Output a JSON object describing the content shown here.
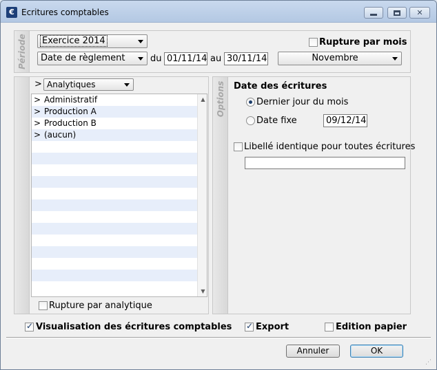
{
  "window": {
    "title": "Ecritures comptables",
    "icon_glyph": "€",
    "minimize_label": "minimize",
    "maximize_label": "maximize",
    "close_glyph": "✕"
  },
  "periode": {
    "section_label": "Période",
    "exercice_value": "Exercice 2014",
    "date_type_value": "Date de règlement",
    "du_label": "du",
    "date_from": "01/11/14",
    "au_label": "au",
    "date_to": "30/11/14",
    "month_value": "Novembre",
    "rupture_mois_label": "Rupture par mois",
    "rupture_mois_checked": false
  },
  "analytique": {
    "chevron": ">",
    "selector_value": "Analytiques",
    "items": [
      {
        "chevron": ">",
        "label": "Administratif"
      },
      {
        "chevron": ">",
        "label": "Production A"
      },
      {
        "chevron": ">",
        "label": "Production B"
      },
      {
        "chevron": ">",
        "label": "(aucun)"
      }
    ],
    "rupture_label": "Rupture par analytique",
    "rupture_checked": false
  },
  "options": {
    "section_label": "Options",
    "date_title": "Date des écritures",
    "radio_last_day_label": "Dernier jour du mois",
    "radio_last_day_checked": true,
    "radio_fixed_label": "Date fixe",
    "radio_fixed_checked": false,
    "fixed_date_value": "09/12/14",
    "libelle_label": "Libellé identique pour toutes écritures",
    "libelle_checked": false,
    "libelle_value": ""
  },
  "footer": {
    "visualisation_label": "Visualisation des écritures comptables",
    "visualisation_checked": true,
    "export_label": "Export",
    "export_checked": true,
    "edition_label": "Edition papier",
    "edition_checked": false,
    "cancel_label": "Annuler",
    "ok_label": "OK"
  },
  "colors": {
    "titlebar": "#b3c8e3",
    "list_alt_row": "#e7eefa",
    "check_mark": "#1b3c6a"
  }
}
